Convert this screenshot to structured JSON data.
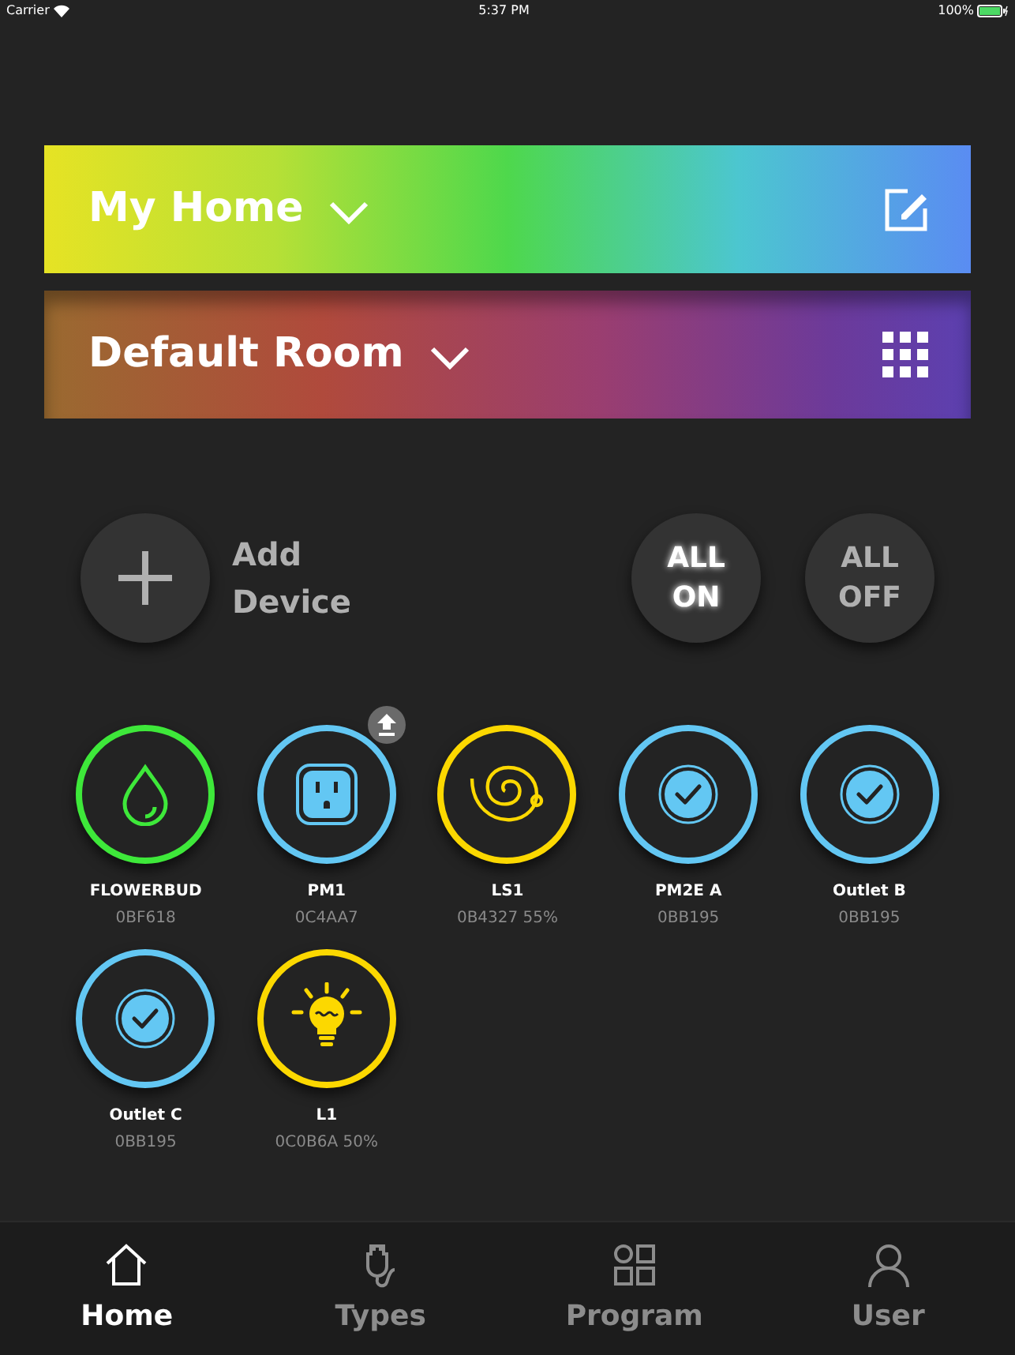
{
  "status_bar": {
    "carrier": "Carrier",
    "time": "5:37 PM",
    "battery": "100%"
  },
  "home": {
    "title": "My Home"
  },
  "room": {
    "title": "Default Room"
  },
  "add_device": {
    "label_line_1": "Add",
    "label_line_2": "Device"
  },
  "power_buttons": [
    {
      "line_1": "ALL",
      "line_2": "ON",
      "active": true
    },
    {
      "line_1": "ALL",
      "line_2": "OFF",
      "active": false
    }
  ],
  "devices": [
    {
      "name": "FLOWERBUD",
      "info": "0BF618",
      "kind": "drop",
      "color": "#3ee83a",
      "update_badge": false
    },
    {
      "name": "PM1",
      "info": "0C4AA7",
      "kind": "outlet",
      "color": "#63c7f3",
      "update_badge": true
    },
    {
      "name": "LS1",
      "info": "0B4327 55%",
      "kind": "spiral",
      "color": "#fcd800",
      "update_badge": false
    },
    {
      "name": "PM2E A",
      "info": "0BB195",
      "kind": "check",
      "color": "#63c7f3",
      "update_badge": false
    },
    {
      "name": "Outlet B",
      "info": "0BB195",
      "kind": "check",
      "color": "#63c7f3",
      "update_badge": false
    },
    {
      "name": "Outlet C",
      "info": "0BB195",
      "kind": "check",
      "color": "#63c7f3",
      "update_badge": false
    },
    {
      "name": "L1",
      "info": "0C0B6A 50%",
      "kind": "bulb",
      "color": "#fcd800",
      "update_badge": false
    }
  ],
  "tabs": [
    {
      "label": "Home",
      "kind": "home",
      "selected": true
    },
    {
      "label": "Types",
      "kind": "plug",
      "selected": false
    },
    {
      "label": "Program",
      "kind": "grid",
      "selected": false
    },
    {
      "label": "User",
      "kind": "user",
      "selected": false
    }
  ]
}
